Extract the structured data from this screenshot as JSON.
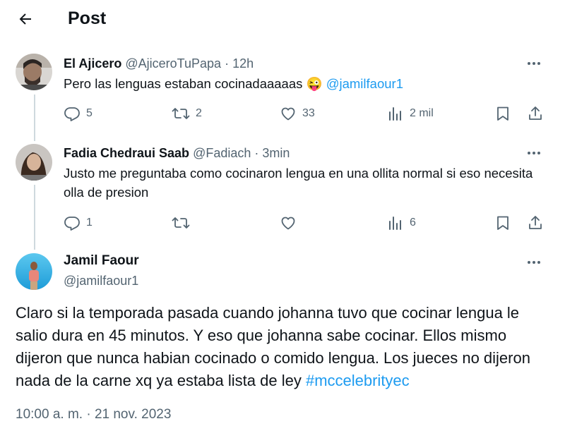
{
  "header": {
    "title": "Post"
  },
  "replies": [
    {
      "name": "El Ajicero",
      "handle": "@AjiceroTuPapa",
      "separator": "·",
      "time": "12h",
      "text": "Pero las lenguas estaban cocinadaaaaas",
      "emoji": "😜",
      "mention": "@jamilfaour1",
      "stats": {
        "replies": "5",
        "reposts": "2",
        "likes": "33",
        "views": "2 mil"
      }
    },
    {
      "name": "Fadia Chedraui Saab",
      "handle": "@Fadiach",
      "separator": "·",
      "time": "3min",
      "text": "Justo me preguntaba como cocinaron lengua en una ollita normal si eso necesita olla de presion",
      "stats": {
        "replies": "1",
        "reposts": "",
        "likes": "",
        "views": "6"
      }
    }
  ],
  "main_post": {
    "name": "Jamil Faour",
    "handle": "@jamilfaour1",
    "text": "Claro si la temporada pasada cuando johanna tuvo que cocinar lengua le salio dura en 45 minutos. Y eso que johanna sabe cocinar. Ellos mismo dijeron que nunca habian cocinado o comido lengua. Los jueces no dijeron nada de la carne xq ya estaba lista de ley",
    "hashtag": "#mccelebrityec",
    "timestamp": "10:00 a. m. · 21 nov. 2023"
  },
  "icons": {
    "back": "back-arrow-icon",
    "more": "more-icon",
    "reply": "reply-icon",
    "repost": "repost-icon",
    "like": "heart-icon",
    "views": "views-icon",
    "bookmark": "bookmark-icon",
    "share": "share-icon"
  },
  "colors": {
    "accent": "#1d9bf0",
    "text": "#0f1419",
    "secondary": "#536471",
    "thread": "#cfd9de"
  }
}
